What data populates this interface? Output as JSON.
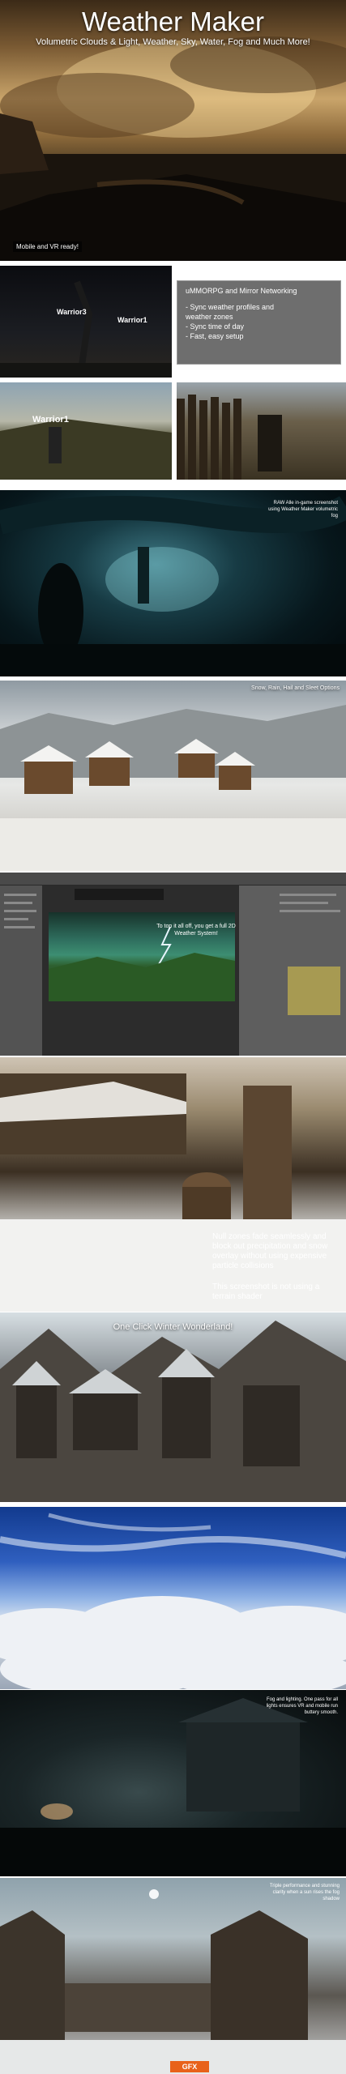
{
  "hero": {
    "title": "Weather Maker",
    "subtitle": "Volumetric Clouds & Light, Weather, Sky, Water, Fog and Much More!",
    "badge": "Mobile and VR ready!"
  },
  "networking": {
    "nametags": [
      "Warrior3",
      "Warrior1",
      "Warrior1"
    ],
    "heading": "uMMORPG and Mirror Networking",
    "bullets": [
      "- Sync weather profiles and",
      "  weather zones",
      "- Sync time of day",
      "- Fast, easy setup"
    ]
  },
  "night": {
    "caption": "RAW Alle in-game screenshot using Weather Maker volumetric fog"
  },
  "snow": {
    "caption": "Snow, Rain, Hail and Sleet Options"
  },
  "editor": {
    "caption": "To top it all off, you get a full 2D Weather System!"
  },
  "null_zones": {
    "caption": "Null zones fade seamlessly and block out precipitation and snow overlay without using expensive particle collisions",
    "caption2": "This screenshot is not using a terrain shader"
  },
  "winter": {
    "caption": "One Click Winter Wonderland!"
  },
  "fog": {
    "caption": "Fog and lighting. One pass for all lights ensures VR and mobile run buttery smooth."
  },
  "final": {
    "caption": "Triple performance and stunning clarity when a sun rises the fog shadow",
    "watermark": "GFX"
  }
}
